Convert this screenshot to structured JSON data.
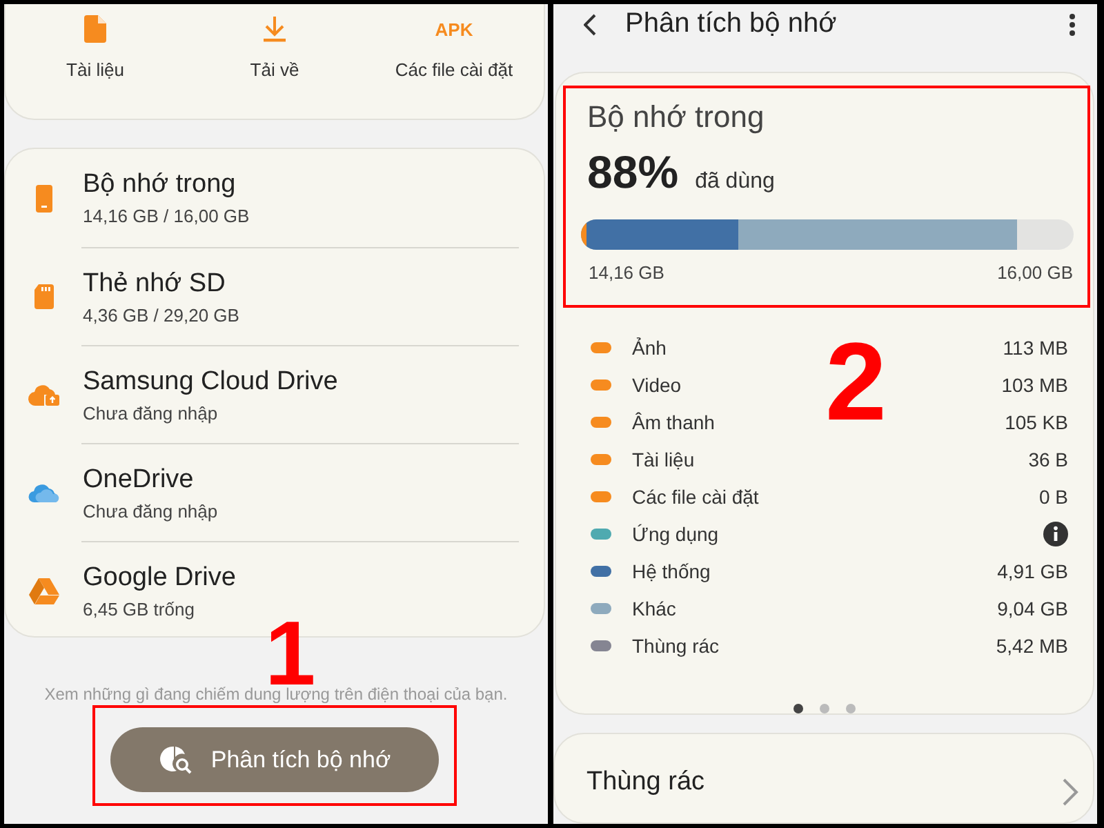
{
  "left_screen": {
    "categories": [
      {
        "label": "Tài liệu",
        "kind": "document"
      },
      {
        "label": "Tải về",
        "kind": "download"
      },
      {
        "label": "Các file cài đặt",
        "kind": "badge",
        "badge": "APK"
      }
    ],
    "storage_locations": [
      {
        "name": "Bộ nhớ trong",
        "detail": "14,16 GB / 16,00 GB",
        "kind": "phone"
      },
      {
        "name": "Thẻ nhớ SD",
        "detail": "4,36 GB / 29,20 GB",
        "kind": "sdcard"
      },
      {
        "name": "Samsung Cloud Drive",
        "detail": "Chưa đăng nhập",
        "kind": "cloud"
      },
      {
        "name": "OneDrive",
        "detail": "Chưa đăng nhập",
        "kind": "onedrive"
      },
      {
        "name": "Google Drive",
        "detail": "6,45 GB trống",
        "kind": "drive"
      }
    ],
    "hint": "Xem những gì đang chiếm dung lượng trên điện thoại của bạn.",
    "analyze_button": {
      "label": "Phân tích bộ nhớ",
      "highlighted": true
    },
    "annotation": "1"
  },
  "right_screen": {
    "title": "Phân tích bộ nhớ",
    "summary": {
      "title": "Bộ nhớ trong",
      "percent": "88%",
      "percent_label": "đã dùng",
      "highlighted": true,
      "used": "14,16 GB",
      "total": "16,00 GB"
    },
    "annotation": "2",
    "breakdown": [
      {
        "label": "Ảnh",
        "value": "113 MB",
        "color": "#f68b1f",
        "kind": "size"
      },
      {
        "label": "Video",
        "value": "103 MB",
        "color": "#f68b1f",
        "kind": "size"
      },
      {
        "label": "Âm thanh",
        "value": "105 KB",
        "color": "#f68b1f",
        "kind": "size"
      },
      {
        "label": "Tài liệu",
        "value": "36 B",
        "color": "#f68b1f",
        "kind": "size"
      },
      {
        "label": "Các file cài đặt",
        "value": "0 B",
        "color": "#f68b1f",
        "kind": "size"
      },
      {
        "label": "Ứng dụng",
        "color": "#4faab0",
        "kind": "info"
      },
      {
        "label": "Hệ thống",
        "value": "4,91 GB",
        "color": "#4170a5",
        "kind": "size"
      },
      {
        "label": "Khác",
        "value": "9,04 GB",
        "color": "#8eaabd",
        "kind": "size"
      },
      {
        "label": "Thùng rác",
        "value": "5,42 MB",
        "color": "#858592",
        "kind": "size"
      }
    ],
    "pages": [
      {
        "selected": true
      },
      {
        "selected": false
      },
      {
        "selected": false
      }
    ],
    "trash_card": {
      "title": "Thùng rác"
    }
  }
}
